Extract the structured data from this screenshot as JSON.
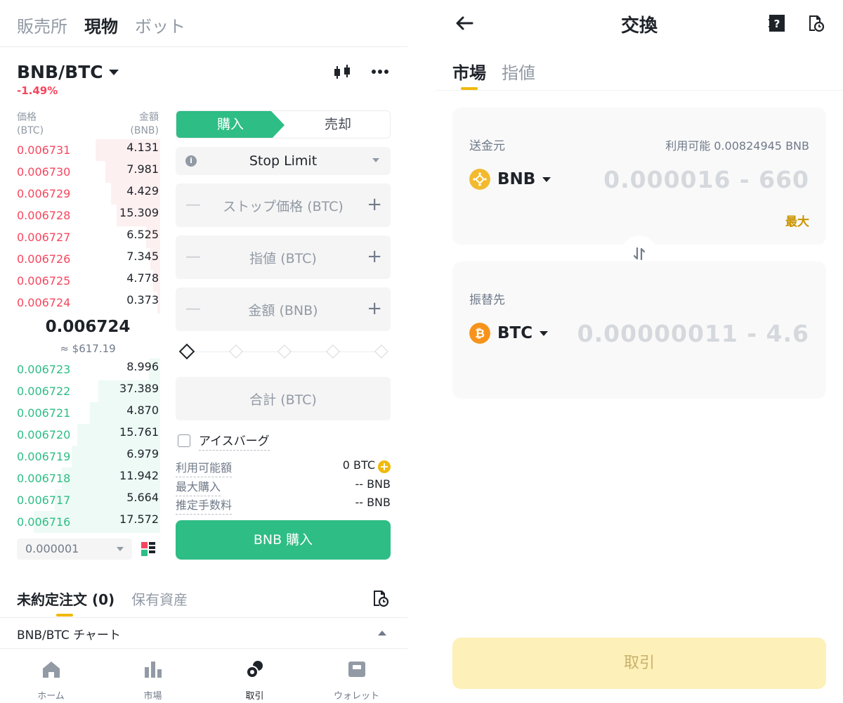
{
  "left": {
    "top_tabs": [
      "販売所",
      "現物",
      "ボット"
    ],
    "pair": "BNB/BTC",
    "change": "-1.49%",
    "orderbook": {
      "price_header": "価格",
      "price_unit": "(BTC)",
      "qty_header": "金額",
      "qty_unit": "(BNB)",
      "asks": [
        {
          "price": "0.006731",
          "qty": "4.131"
        },
        {
          "price": "0.006730",
          "qty": "7.981"
        },
        {
          "price": "0.006729",
          "qty": "4.429"
        },
        {
          "price": "0.006728",
          "qty": "15.309"
        },
        {
          "price": "0.006727",
          "qty": "6.525"
        },
        {
          "price": "0.006726",
          "qty": "7.345"
        },
        {
          "price": "0.006725",
          "qty": "4.778"
        },
        {
          "price": "0.006724",
          "qty": "0.373"
        }
      ],
      "mid_price": "0.006724",
      "mid_fiat": "≈ $617.19",
      "bids": [
        {
          "price": "0.006723",
          "qty": "8.996"
        },
        {
          "price": "0.006722",
          "qty": "37.389"
        },
        {
          "price": "0.006721",
          "qty": "4.870"
        },
        {
          "price": "0.006720",
          "qty": "15.761"
        },
        {
          "price": "0.006719",
          "qty": "6.979"
        },
        {
          "price": "0.006718",
          "qty": "11.942"
        },
        {
          "price": "0.006717",
          "qty": "5.664"
        },
        {
          "price": "0.006716",
          "qty": "17.572"
        }
      ],
      "precision": "0.000001"
    },
    "form": {
      "buy_label": "購入",
      "sell_label": "売却",
      "order_type": "Stop Limit",
      "stop_price_placeholder": "ストップ価格 (BTC)",
      "limit_price_placeholder": "指値 (BTC)",
      "amount_placeholder": "金額 (BNB)",
      "total_placeholder": "合計 (BTC)",
      "iceberg_label": "アイスバーグ",
      "available_label": "利用可能額",
      "available_value": "0 BTC",
      "max_buy_label": "最大購入",
      "max_buy_value": "-- BNB",
      "fee_label": "推定手数料",
      "fee_value": "-- BNB",
      "submit_label": "BNB 購入"
    },
    "orders_tabs": [
      "未約定注文 (0)",
      "保有資産"
    ],
    "chart_row": "BNB/BTC チャート",
    "bottom_nav": [
      "ホーム",
      "市場",
      "取引",
      "ウォレット"
    ]
  },
  "right": {
    "title": "交換",
    "tabs": [
      "市場",
      "指値"
    ],
    "from": {
      "label": "送金元",
      "available": "利用可能 0.00824945 BNB",
      "coin": "BNB",
      "range": "0.000016 - 660",
      "max": "最大"
    },
    "to": {
      "label": "振替先",
      "coin": "BTC",
      "range": "0.00000011 - 4.6"
    },
    "trade_button": "取引"
  },
  "colors": {
    "buy_green": "#2ebd85",
    "sell_red": "#f6465d",
    "accent_yellow": "#f0b90b",
    "bnb_yellow": "#f3ba2f",
    "btc_orange": "#f7931a"
  }
}
